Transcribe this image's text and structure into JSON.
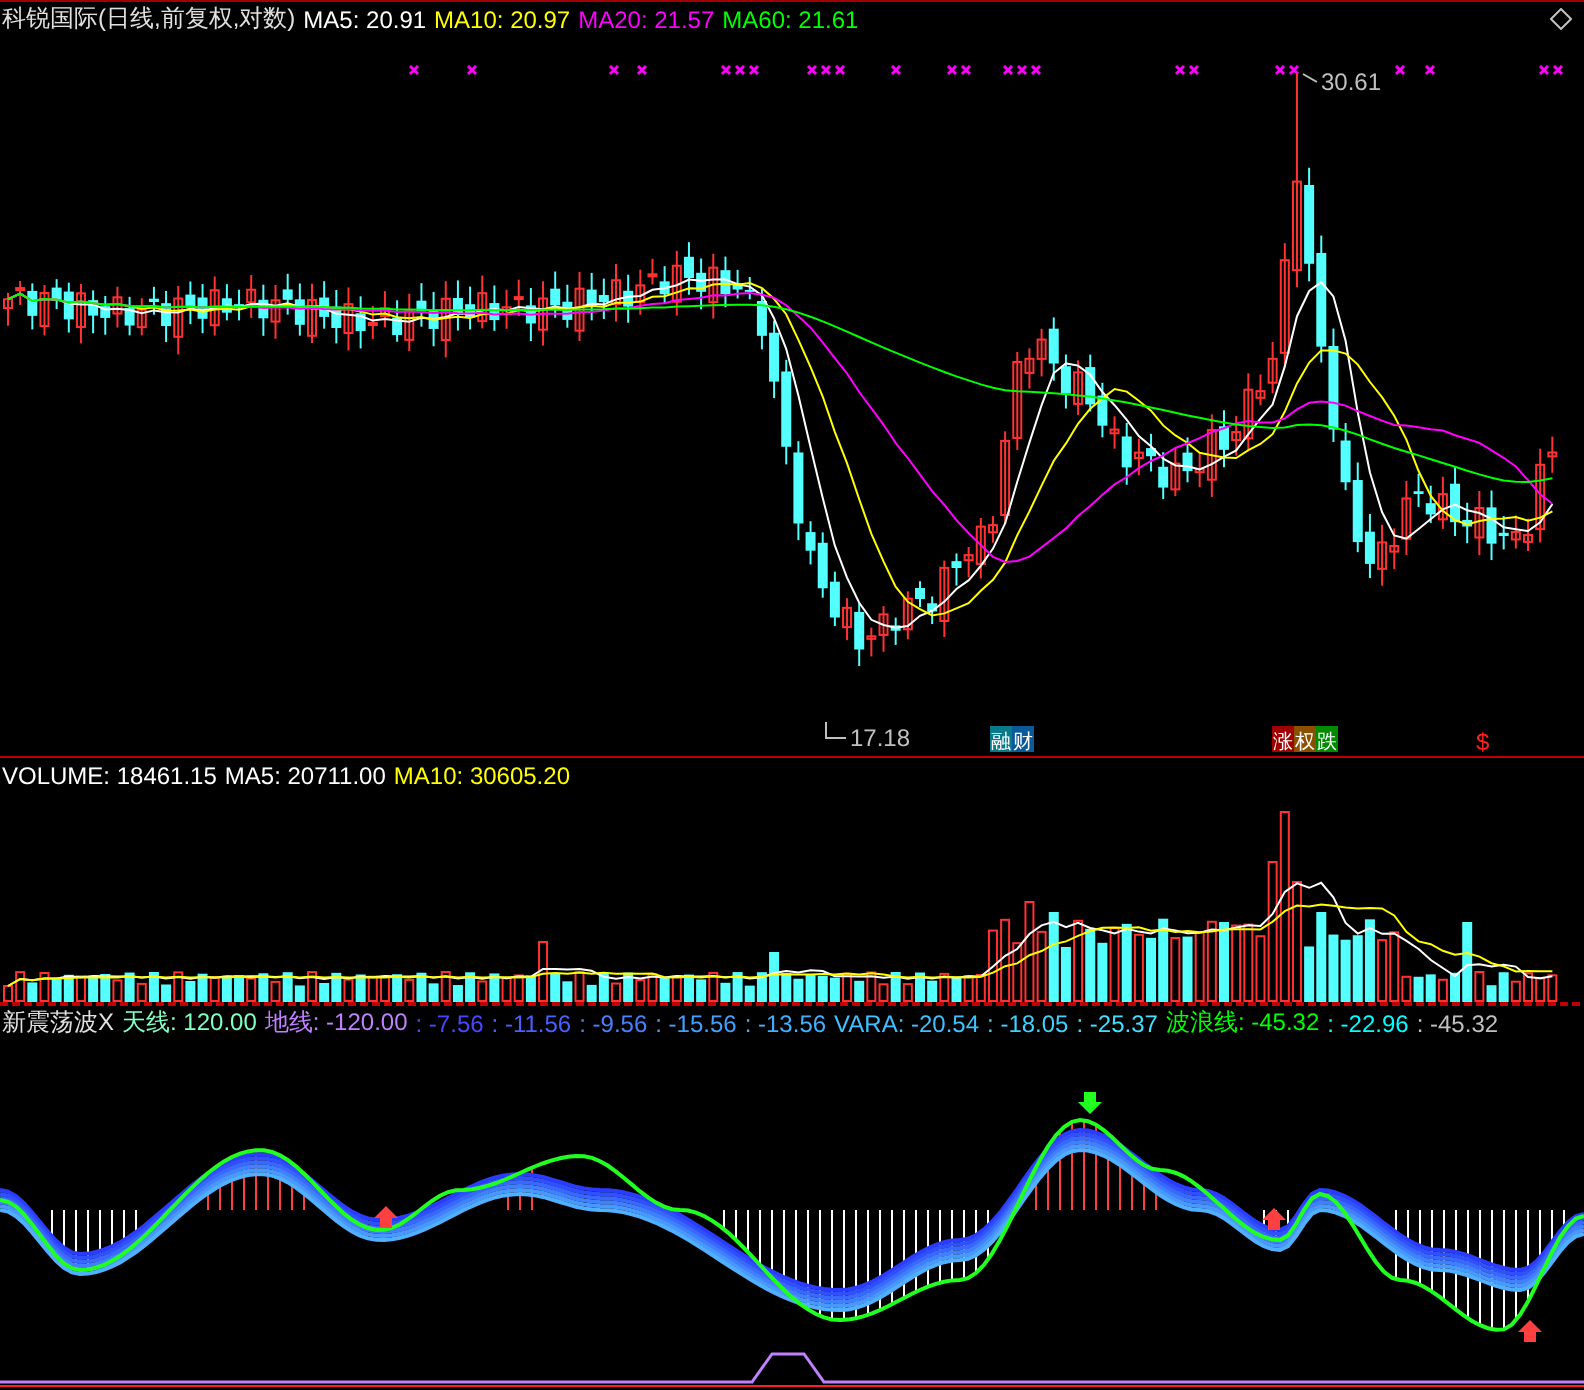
{
  "price_panel": {
    "title": "科锐国际(日线,前复权,对数)",
    "indicators": [
      {
        "label": "MA5: 20.91",
        "color": "#ffffff"
      },
      {
        "label": "MA10: 20.97",
        "color": "#ffff00"
      },
      {
        "label": "MA20: 21.57",
        "color": "#ff00ff"
      },
      {
        "label": "MA60: 21.61",
        "color": "#00ff00"
      }
    ],
    "high_label": "30.61",
    "low_label": "17.18",
    "tags": [
      {
        "text": "融",
        "color": "#0a7a8a"
      },
      {
        "text": "财",
        "color": "#0a5a9a"
      },
      {
        "text": "涨",
        "color": "#a00000"
      },
      {
        "text": "权",
        "color": "#8a5000"
      },
      {
        "text": "跌",
        "color": "#008a00"
      }
    ],
    "dollar_mark": "$"
  },
  "volume_panel": {
    "indicators": [
      {
        "label": "VOLUME: 18461.15",
        "color": "#ffffff"
      },
      {
        "label": "MA5: 20711.00",
        "color": "#ffffff"
      },
      {
        "label": "MA10: 30605.20",
        "color": "#ffff00"
      }
    ]
  },
  "oscillator_panel": {
    "title": "新震荡波X",
    "indicators": [
      {
        "label": "天线: 120.00",
        "color": "#80ffc0"
      },
      {
        "label": "地线: -120.00",
        "color": "#c080ff"
      },
      {
        "label": ": -7.56",
        "color": "#4848ff"
      },
      {
        "label": ": -11.56",
        "color": "#4860ff"
      },
      {
        "label": ": -9.56",
        "color": "#4880ff"
      },
      {
        "label": ": -15.56",
        "color": "#40a0ff"
      },
      {
        "label": ": -13.56",
        "color": "#40b0ff"
      },
      {
        "label": "VARA: -20.54",
        "color": "#40c0ff"
      },
      {
        "label": ": -18.05",
        "color": "#40d0ff"
      },
      {
        "label": ": -25.37",
        "color": "#40e0ff"
      },
      {
        "label": "波浪线: -45.32",
        "color": "#00ff00"
      },
      {
        "label": ": -22.96",
        "color": "#00ffff"
      },
      {
        "label": ": -45.32",
        "color": "#c0c0c0"
      }
    ]
  }
}
